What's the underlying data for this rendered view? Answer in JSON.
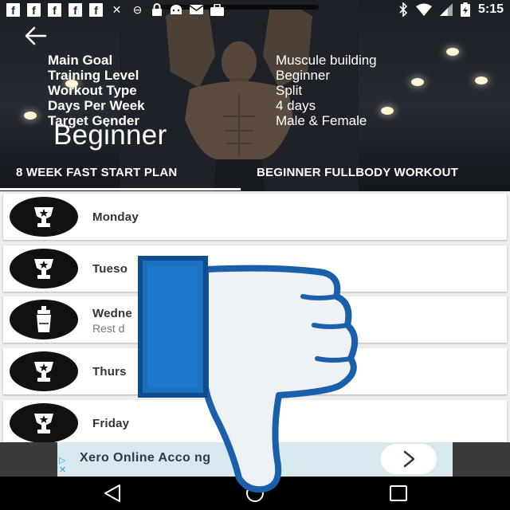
{
  "status_bar": {
    "notification_icons": [
      "facebook-icon",
      "facebook-icon",
      "facebook-icon",
      "facebook-icon",
      "facebook-icon",
      "tools-icon",
      "do-not-disturb-icon",
      "lock-icon",
      "android-icon",
      "mail-icon",
      "briefcase-icon"
    ],
    "fb_glyph": "f",
    "right_icons": [
      "bluetooth-icon",
      "wifi-icon",
      "signal-icon",
      "battery-charging-icon"
    ],
    "time": "5:15"
  },
  "header": {
    "back_icon": "arrow-left-icon",
    "info": [
      {
        "label": "Main Goal",
        "value": "Muscule building"
      },
      {
        "label": "Training Level",
        "value": "Beginner"
      },
      {
        "label": "Workout Type",
        "value": "Split"
      },
      {
        "label": "Days Per Week",
        "value": "4 days"
      },
      {
        "label": "Target Gender",
        "value": "Male & Female"
      }
    ],
    "level_title": "Beginner"
  },
  "tabs": [
    {
      "label": "8 WEEK FAST START PLAN",
      "selected": true
    },
    {
      "label": "BEGINNER FULLBODY WORKOUT",
      "selected": false
    }
  ],
  "days": [
    {
      "name": "Monday",
      "sub": "",
      "icon": "trophy-icon"
    },
    {
      "name": "Tueso",
      "sub": "",
      "icon": "trophy-icon"
    },
    {
      "name": "Wedne",
      "sub": "Rest d",
      "icon": "shaker-bottle-icon"
    },
    {
      "name": "Thurs",
      "sub": "",
      "icon": "trophy-icon"
    },
    {
      "name": "Friday",
      "sub": "",
      "icon": "trophy-icon"
    }
  ],
  "ad": {
    "text": "Xero Online Acco         ng",
    "button_icon": "chevron-right-icon",
    "adchoices_icon": "adchoices-icon"
  },
  "nav": {
    "back": "nav-back-icon",
    "home": "nav-home-icon",
    "recents": "nav-recents-icon"
  },
  "overlay": {
    "icon": "thumbs-down-icon"
  },
  "colors": {
    "hero_bg": "#1e232b",
    "card_bg": "#ffffff",
    "list_bg": "#eeeeee",
    "thumb_cuff": "#1a6fbf",
    "thumb_fill": "#eef1f5",
    "thumb_stroke": "#1a5faa"
  }
}
